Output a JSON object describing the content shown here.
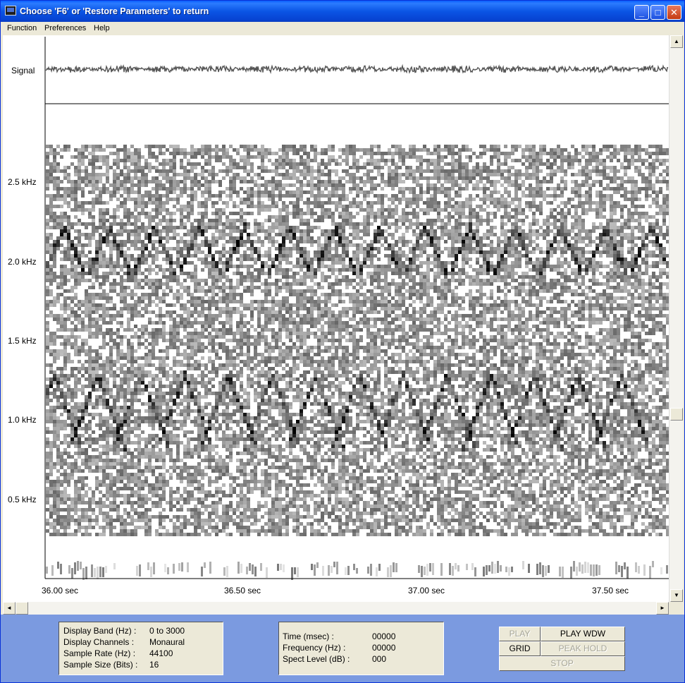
{
  "window": {
    "title": "Choose 'F6' or 'Restore Parameters' to return",
    "min_glyph": "_",
    "max_glyph": "□",
    "close_glyph": "✕"
  },
  "menu": {
    "items": [
      "Function",
      "Preferences",
      "Help"
    ]
  },
  "plot": {
    "signal_label": "Signal",
    "y_labels": [
      "2.5 kHz",
      "2.0 kHz",
      "1.5 kHz",
      "1.0 kHz",
      "0.5 kHz"
    ],
    "x_labels": [
      "36.00 sec",
      "36.50 sec",
      "37.00 sec",
      "37.50 sec"
    ]
  },
  "scrollbars": {
    "up_glyph": "▲",
    "down_glyph": "▼",
    "left_glyph": "◄",
    "right_glyph": "►"
  },
  "settings_panel": {
    "rows": [
      {
        "label": "Display Band (Hz) :",
        "value": "0 to 3000"
      },
      {
        "label": "Display Channels :",
        "value": "Monaural"
      },
      {
        "label": "Sample Rate (Hz) :",
        "value": "44100"
      },
      {
        "label": "Sample Size (Bits) :",
        "value": "16"
      }
    ]
  },
  "readout_panel": {
    "rows": [
      {
        "label": "Time (msec) :",
        "value": "00000"
      },
      {
        "label": "Frequency (Hz) :",
        "value": "00000"
      },
      {
        "label": "Spect Level (dB) :",
        "value": "000"
      }
    ]
  },
  "controls": {
    "play": "PLAY",
    "play_wdw": "PLAY WDW",
    "grid": "GRID",
    "peak_hold": "PEAK HOLD",
    "stop": "STOP"
  },
  "colors": {
    "titlebar": "#0b55e5",
    "panel_bg": "#7b9ae0",
    "face": "#ece9d8",
    "spectrogram_ink": "#000000"
  }
}
